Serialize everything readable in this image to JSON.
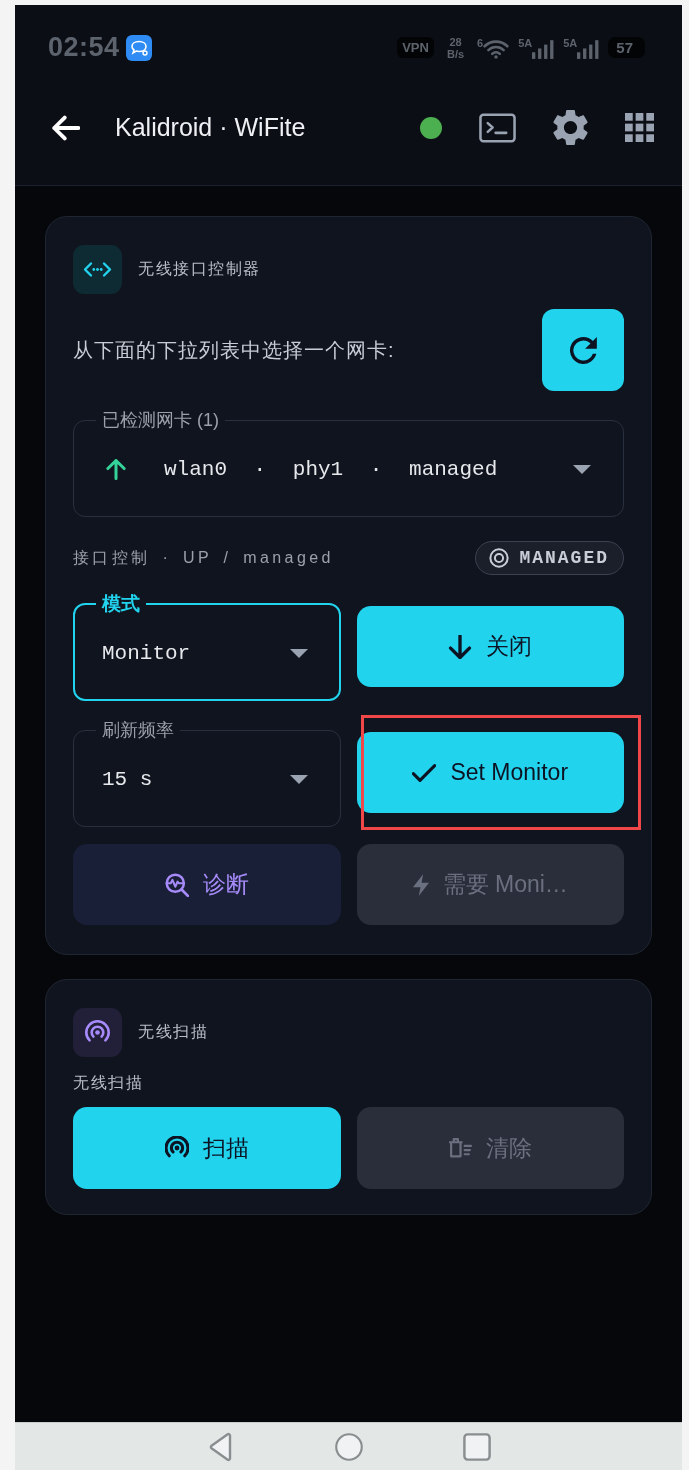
{
  "status_bar": {
    "time": "02:54",
    "vpn": "VPN",
    "speed_value": "28",
    "speed_unit": "B/s",
    "wifi_label": "6",
    "signal_labels": [
      "5A",
      "5A"
    ],
    "battery": "57"
  },
  "app_bar": {
    "title": "Kalidroid · WiFite",
    "connected": true
  },
  "interface_card": {
    "title": "无线接口控制器",
    "instruction": "从下面的下拉列表中选择一个网卡:",
    "adapter_select": {
      "label": "已检测网卡 (1)",
      "value": "wlan0 · phy1 · managed",
      "link_up": true
    },
    "status_line": "接口控制 · UP / managed",
    "mode_badge": "MANAGED",
    "mode_select": {
      "label": "模式",
      "value": "Monitor",
      "focused": true
    },
    "power_button": {
      "label": "关闭",
      "disabled": false
    },
    "refresh_select": {
      "label": "刷新频率",
      "value": "15 s",
      "focused": false
    },
    "set_monitor_button": {
      "label": "Set Monitor",
      "disabled": false,
      "highlighted": true
    },
    "diagnose_button": {
      "label": "诊断",
      "disabled": false
    },
    "monitor_required_button": {
      "label": "需要 Moni…",
      "disabled": true
    }
  },
  "scan_card": {
    "title": "无线扫描",
    "subtitle": "无线扫描",
    "scan_button": {
      "label": "扫描",
      "disabled": false
    },
    "clear_button": {
      "label": "清除",
      "disabled": true
    }
  }
}
